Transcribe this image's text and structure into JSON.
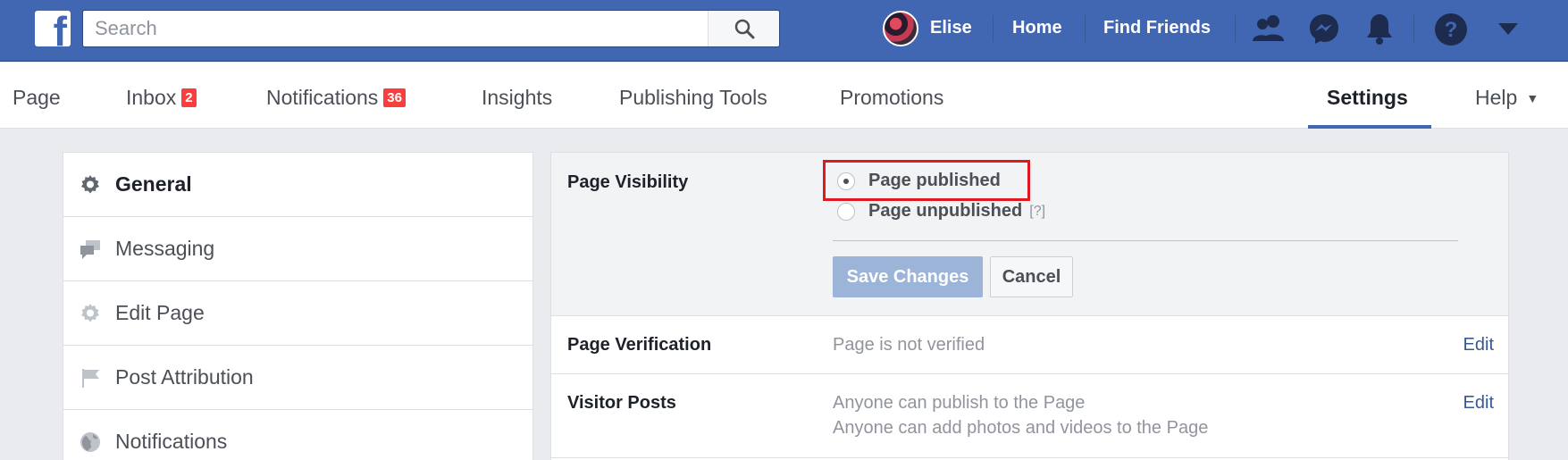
{
  "topbar": {
    "search_placeholder": "Search",
    "user_name": "Elise",
    "home_label": "Home",
    "find_friends_label": "Find Friends"
  },
  "page_nav": {
    "page": "Page",
    "inbox": "Inbox",
    "inbox_count": "2",
    "notifications": "Notifications",
    "notifications_count": "36",
    "insights": "Insights",
    "publishing_tools": "Publishing Tools",
    "promotions": "Promotions",
    "settings": "Settings",
    "help": "Help"
  },
  "sidebar": {
    "items": [
      {
        "label": "General",
        "icon": "gear-icon"
      },
      {
        "label": "Messaging",
        "icon": "chat-bubbles-icon"
      },
      {
        "label": "Edit Page",
        "icon": "gear-icon"
      },
      {
        "label": "Post Attribution",
        "icon": "flag-icon"
      },
      {
        "label": "Notifications",
        "icon": "globe-icon"
      }
    ]
  },
  "visibility": {
    "title": "Page Visibility",
    "option_published": "Page published",
    "option_unpublished": "Page unpublished",
    "help_marker": "[?]",
    "save_label": "Save Changes",
    "cancel_label": "Cancel"
  },
  "rows": [
    {
      "title": "Page Verification",
      "value_lines": [
        "Page is not verified"
      ],
      "edit": "Edit"
    },
    {
      "title": "Visitor Posts",
      "value_lines": [
        "Anyone can publish to the Page",
        "Anyone can add photos and videos to the Page"
      ],
      "edit": "Edit"
    }
  ],
  "colors": {
    "brand": "#4267b2",
    "badge": "#fa3e3e",
    "highlight": "#e0191f",
    "link": "#365899"
  }
}
